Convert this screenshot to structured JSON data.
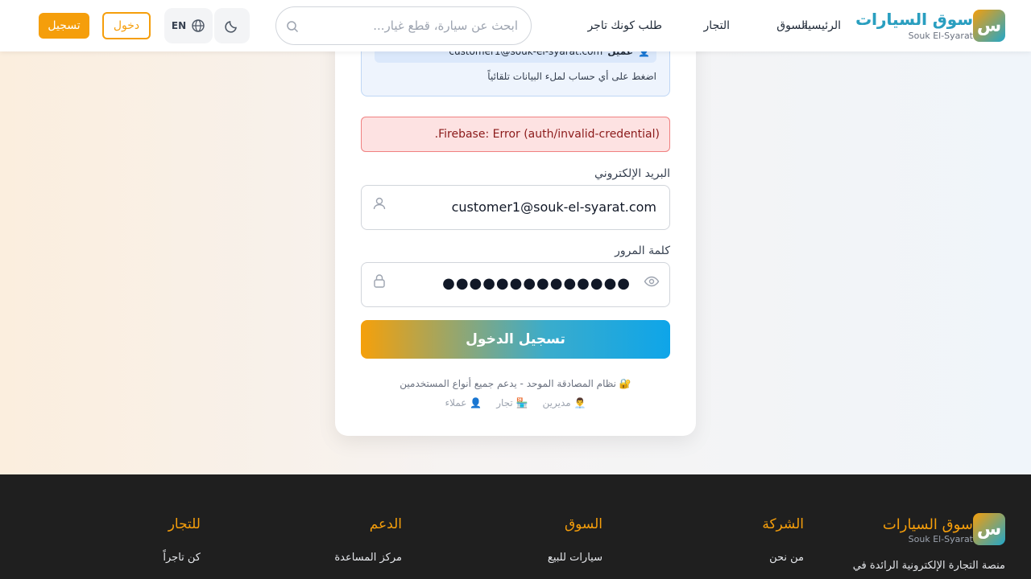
{
  "brand": {
    "name": "سوق السيارات",
    "subtitle": "Souk El-Syarat",
    "logo_letter": "س"
  },
  "nav": {
    "home": "الرئيسية",
    "market": "السوق",
    "dealers": "التجار",
    "become_dealer": "طلب كونك تاجر"
  },
  "search": {
    "placeholder": "ابحث عن سيارة، قطع غيار..."
  },
  "header_actions": {
    "language": "EN",
    "login": "دخول",
    "register": "تسجيل"
  },
  "demo": {
    "account_name": "عميل",
    "account_email": "customer1@souk-el-syarat.com",
    "hint": "اضغط على أي حساب لملء البيانات تلقائياً"
  },
  "error_message": "Firebase: Error (auth/invalid-credential).",
  "form": {
    "email_label": "البريد الإلكتروني",
    "email_value": "customer1@souk-el-syarat.com",
    "password_label": "كلمة المرور",
    "password_value": "●●●●●●●●●●●●●●",
    "submit": "تسجيل الدخول"
  },
  "footnote": "🔐 نظام المصادقة الموحد - يدعم جميع أنواع المستخدمين",
  "roles": [
    {
      "icon": "👨‍💼",
      "label": "مديرين"
    },
    {
      "icon": "🏪",
      "label": "تجار"
    },
    {
      "icon": "👤",
      "label": "عملاء"
    }
  ],
  "footer": {
    "description": "منصة التجارة الإلكترونية الرائدة في",
    "columns": [
      {
        "title": "الشركة",
        "first_link": "من نحن"
      },
      {
        "title": "السوق",
        "first_link": "سيارات للبيع"
      },
      {
        "title": "الدعم",
        "first_link": "مركز المساعدة"
      },
      {
        "title": "للتجار",
        "first_link": "كن تاجراً"
      }
    ]
  },
  "colors": {
    "accent": "#f59e0b",
    "brand_teal": "#22a7c9",
    "error_bg": "#fde2e2",
    "footer_bg": "#1f1f1f"
  }
}
